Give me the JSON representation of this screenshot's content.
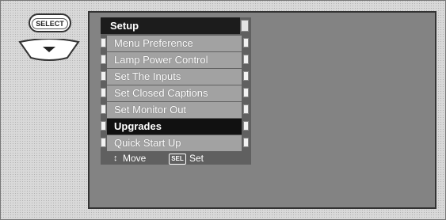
{
  "remote": {
    "select_label": "SELECT",
    "down_button": "chevron-down-icon"
  },
  "menu": {
    "title": "Setup",
    "items": [
      {
        "label": "Menu Preference",
        "selected": false
      },
      {
        "label": "Lamp Power Control",
        "selected": false
      },
      {
        "label": "Set The Inputs",
        "selected": false
      },
      {
        "label": "Set Closed Captions",
        "selected": false
      },
      {
        "label": "Set Monitor Out",
        "selected": false
      },
      {
        "label": "Upgrades",
        "selected": true
      },
      {
        "label": "Quick Start Up",
        "selected": false
      }
    ],
    "footer": {
      "move_label": "Move",
      "sel_key": "SEL",
      "set_label": "Set"
    }
  },
  "colors": {
    "menu_bg": "#5a5a5a",
    "item_bg": "#b9b9b9",
    "selected_bg": "#111111",
    "screen_bg": "#9a9a9a"
  }
}
